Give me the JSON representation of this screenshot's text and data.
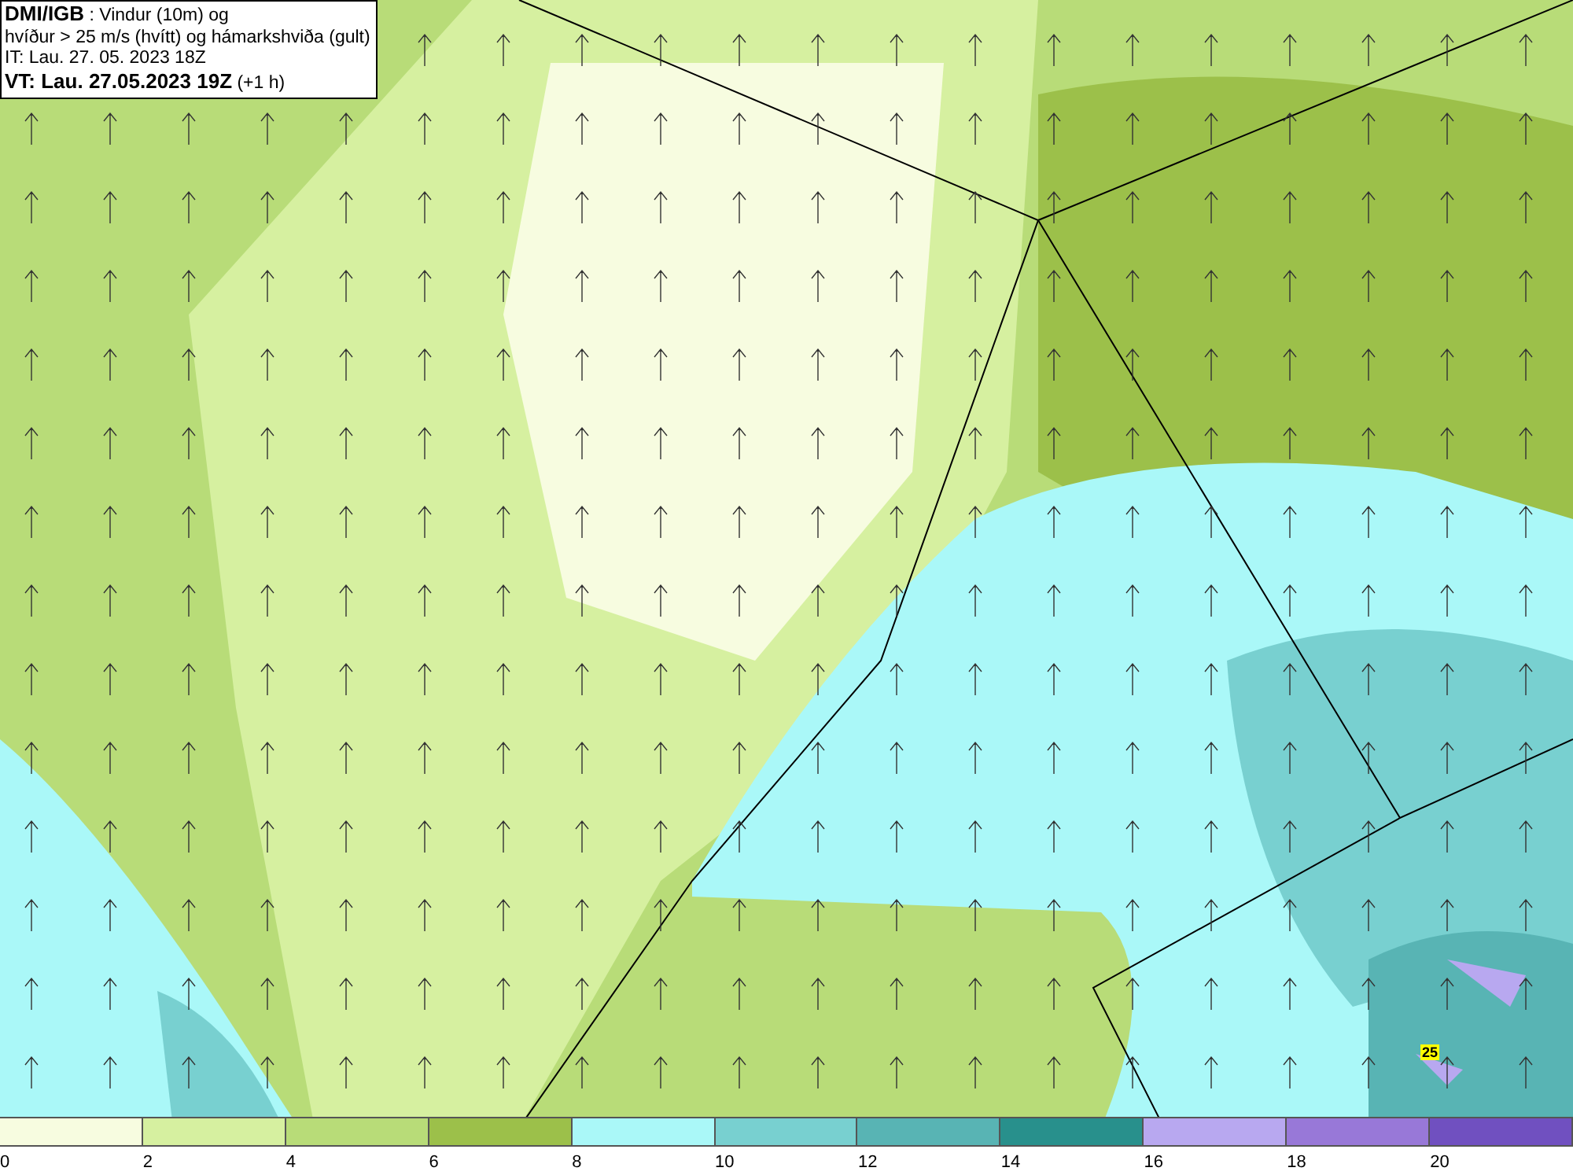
{
  "title_box": {
    "lines": [
      "**DMI/IGB** : Vindur (10m) og",
      "hvíður > 25 m/s (hvítt) og hámarkshviða (gult)",
      "IT: Lau. 27. 05. 2023 18Z",
      "**VT: Lau. 27.05.2023 19Z** (+1 h)"
    ]
  },
  "map": {
    "gust_labels": [
      "25"
    ]
  },
  "legend": [
    {
      "label": "0",
      "color": "#f7fce0"
    },
    {
      "label": "2",
      "color": "#d6f0a0"
    },
    {
      "label": "4",
      "color": "#b8dc78"
    },
    {
      "label": "6",
      "color": "#9cc04a"
    },
    {
      "label": "8",
      "color": "#aaf8f8"
    },
    {
      "label": "10",
      "color": "#78d0d0"
    },
    {
      "label": "12",
      "color": "#58b4b4"
    },
    {
      "label": "14",
      "color": "#28908c"
    },
    {
      "label": "16",
      "color": "#b8a8f0"
    },
    {
      "label": "18",
      "color": "#9878d8"
    },
    {
      "label": "20",
      "color": "#7050c0"
    }
  ]
}
